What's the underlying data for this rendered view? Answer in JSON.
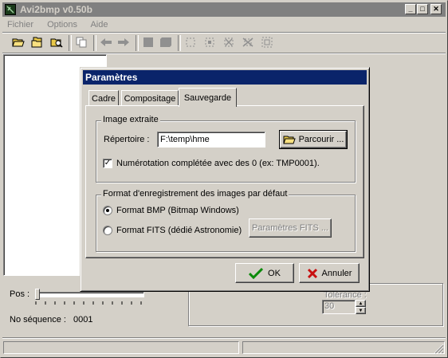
{
  "main_window": {
    "title": "Avi2bmp v0.50b",
    "menu": [
      "Fichier",
      "Options",
      "Aide"
    ],
    "pos_label": "Pos :",
    "sequence_label": "No séquence :",
    "sequence_value": "0001",
    "tolerance_label": "Tolérance :",
    "tolerance_value": "30"
  },
  "dialog": {
    "title": "Paramètres",
    "tabs": [
      "Cadre",
      "Compositage",
      "Sauvegarde"
    ],
    "active_tab": "Sauvegarde",
    "image_group": {
      "legend": "Image extraite",
      "directory_label": "Répertoire :",
      "directory_value": "F:\\temp\\hme",
      "browse_button": "Parcourir ...",
      "numbering_checkbox": "Numérotation complétée avec des 0 (ex: TMP0001).",
      "numbering_checked": true
    },
    "format_group": {
      "legend": "Format d'enregistrement des images par défaut",
      "options": [
        "Format BMP (Bitmap Windows)",
        "Format FITS (dédié Astronomie)"
      ],
      "selected": "Format BMP (Bitmap Windows)",
      "fits_params_button": "Paramètres FITS ..."
    },
    "ok_button": "OK",
    "cancel_button": "Annuler"
  }
}
